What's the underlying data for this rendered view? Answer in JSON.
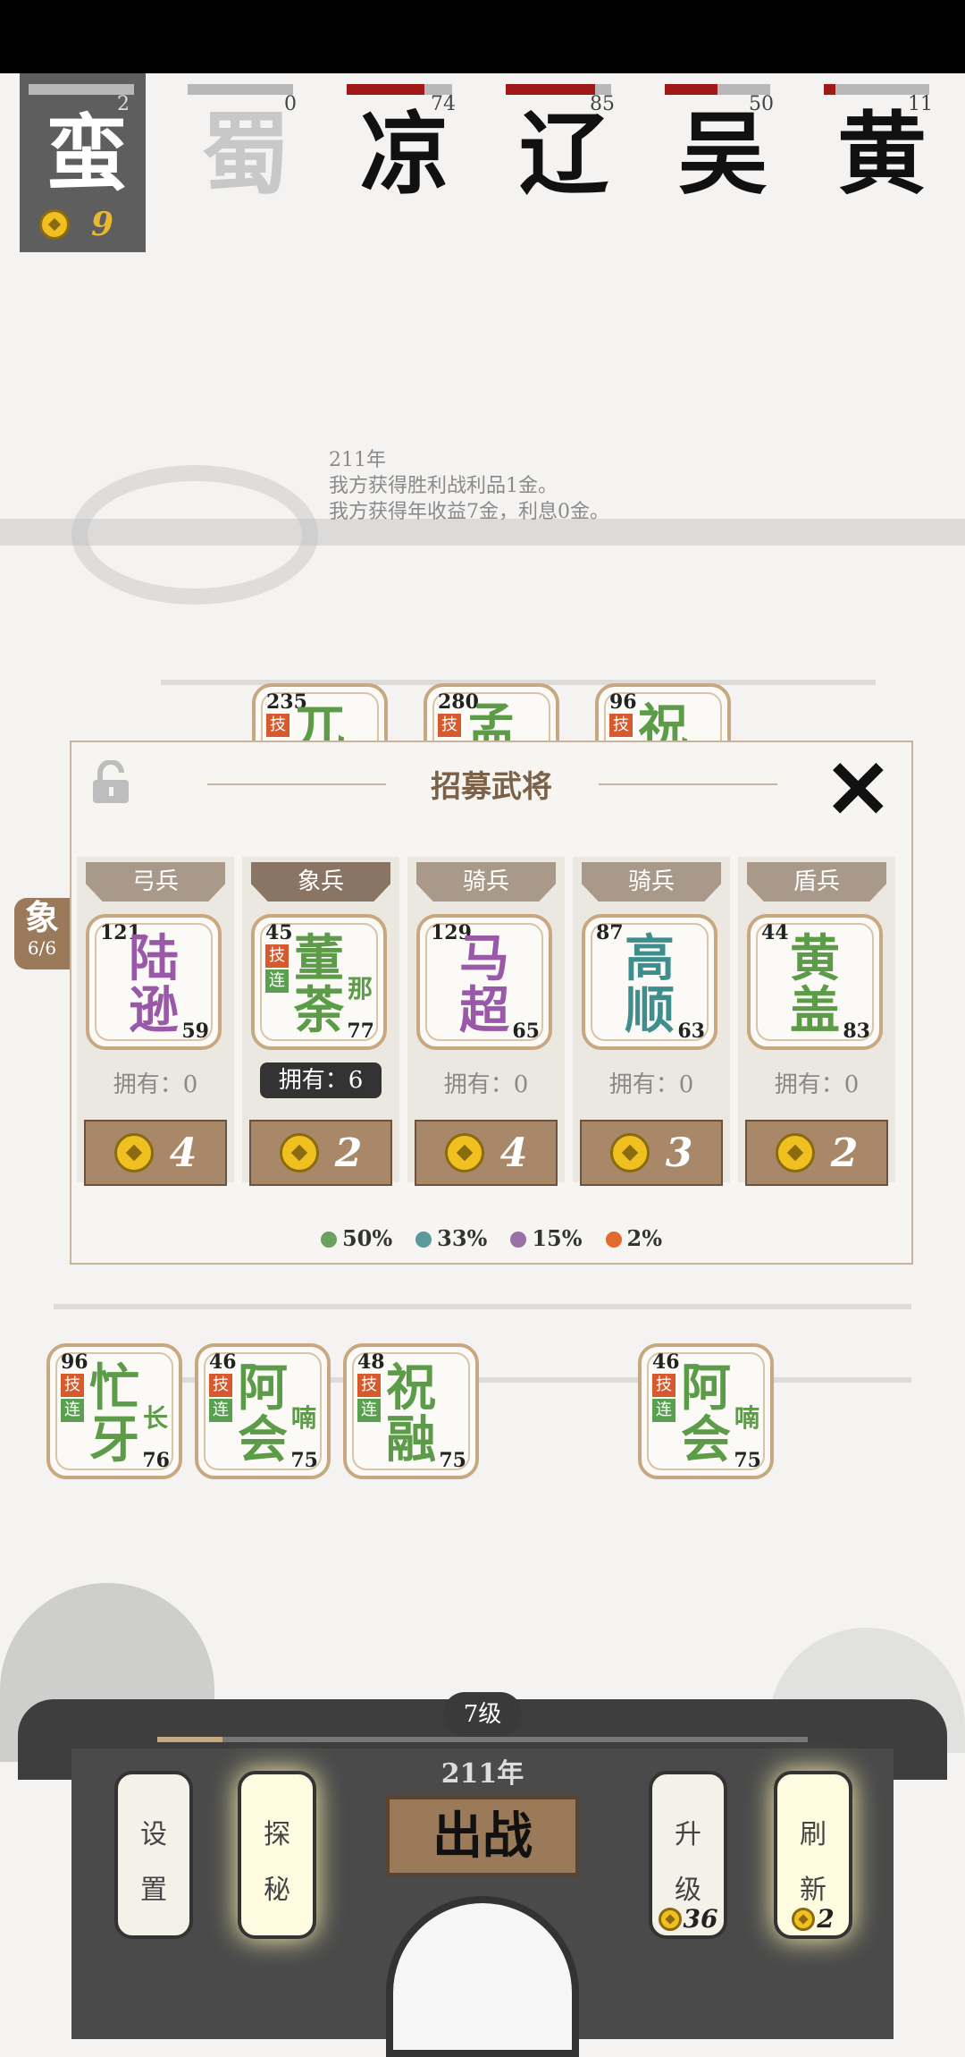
{
  "factions": [
    {
      "name": "蛮",
      "count": "2",
      "hp": 1.0,
      "selected": true,
      "gold": "9"
    },
    {
      "name": "蜀",
      "count": "0",
      "hp": 0.0,
      "dim": true
    },
    {
      "name": "凉",
      "count": "74",
      "hp": 0.74
    },
    {
      "name": "辽",
      "count": "85",
      "hp": 0.85
    },
    {
      "name": "吴",
      "count": "50",
      "hp": 0.5
    },
    {
      "name": "黄",
      "count": "11",
      "hp": 0.11
    }
  ],
  "log": [
    "211年",
    "我方获得胜利战利品1金。",
    "我方获得年收益7金，利息0金。"
  ],
  "board_top": [
    {
      "level": "235",
      "name1": "兀"
    },
    {
      "level": "280",
      "name1": "孟"
    },
    {
      "level": "96",
      "name1": "祝"
    }
  ],
  "recruit": {
    "title": "招募武将",
    "cards": [
      {
        "type": "弓兵",
        "level": "121",
        "name1": "陆",
        "name2": "逊",
        "power": "59",
        "color": "purple",
        "owned": "拥有：0",
        "price": "4"
      },
      {
        "type": "象兵",
        "level": "45",
        "name1": "董",
        "name2": "荼",
        "suffix": "那",
        "power": "77",
        "color": "green",
        "owned": "拥有：6",
        "price": "2",
        "selected": true,
        "tags": [
          "技",
          "连"
        ]
      },
      {
        "type": "骑兵",
        "level": "129",
        "name1": "马",
        "name2": "超",
        "power": "65",
        "color": "purple",
        "owned": "拥有：0",
        "price": "4"
      },
      {
        "type": "骑兵",
        "level": "87",
        "name1": "高",
        "name2": "顺",
        "power": "63",
        "color": "teal",
        "owned": "拥有：0",
        "price": "3"
      },
      {
        "type": "盾兵",
        "level": "44",
        "name1": "黄",
        "name2": "盖",
        "power": "83",
        "color": "green",
        "owned": "拥有：0",
        "price": "2"
      }
    ],
    "odds": [
      {
        "pct": "50%",
        "color": "#6aa060"
      },
      {
        "pct": "33%",
        "color": "#5a9a9a"
      },
      {
        "pct": "15%",
        "color": "#9a70a8"
      },
      {
        "pct": "2%",
        "color": "#e06a30"
      }
    ]
  },
  "side_badge": {
    "label": "象",
    "count": "6/6"
  },
  "bench": [
    {
      "level": "96",
      "name1": "忙",
      "name2": "牙",
      "suffix": "长",
      "power": "76"
    },
    {
      "level": "46",
      "name1": "阿",
      "name2": "会",
      "suffix": "喃",
      "power": "75"
    },
    {
      "level": "48",
      "name1": "祝",
      "name2": "融",
      "power": "75"
    },
    {
      "level": "46",
      "name1": "阿",
      "name2": "会",
      "suffix": "喃",
      "power": "75"
    }
  ],
  "bottom": {
    "level": "7级",
    "xp": 0.1,
    "year": "211年",
    "fight": "出战",
    "settings": [
      "设",
      "置"
    ],
    "explore": [
      "探",
      "秘"
    ],
    "upgrade": [
      "升",
      "级"
    ],
    "upgrade_cost": "36",
    "refresh": [
      "刷",
      "新"
    ],
    "refresh_cost": "2"
  }
}
